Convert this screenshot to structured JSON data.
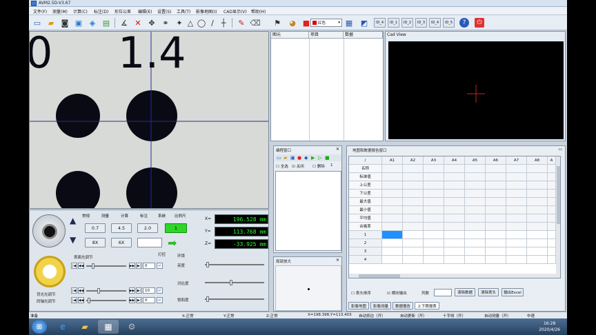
{
  "window": {
    "title": "AVM2.5D-V3.67"
  },
  "menu": [
    "文件(F)",
    "测量(M)",
    "计算(C)",
    "标注(D)",
    "形位公差",
    "编辑(E)",
    "设置(S)",
    "工具(T)",
    "影像地图(I)",
    "CAD显示(V)",
    "帮助(H)"
  ],
  "toolbar": {
    "color_select": "红色",
    "small_buttons": [
      "ID_4",
      "ID_1",
      "ID_2",
      "ID_3",
      "ID_4",
      "ID_5"
    ]
  },
  "camera": {
    "reading": "1.4",
    "left_digit": "0"
  },
  "element_table": {
    "headers": [
      "图元",
      "项目",
      "数据"
    ]
  },
  "cad_view": {
    "title": "Cad View"
  },
  "control": {
    "tabs": [
      "常规",
      "测量",
      "计算",
      "标注",
      "系统",
      "比例尺"
    ],
    "buttons": [
      "0.7",
      "4.5",
      "2.0",
      "1",
      "8X",
      "6X"
    ],
    "coords": [
      {
        "axis": "X=",
        "value": "196.528 mm"
      },
      {
        "axis": "Y=",
        "value": "113.768 mm"
      },
      {
        "axis": "Z=",
        "value": "-33.925 mm"
      }
    ],
    "light_label": "表面光调节",
    "ring_label": "背光光调节",
    "coax_label": "同轴光调节",
    "light_val": "0",
    "ring_val": "10",
    "coax_val": "0",
    "section_label": "环境",
    "light_section": "灯控",
    "brightness": "亮度",
    "contrast": "对比度",
    "saturation": "饱和度"
  },
  "program": {
    "title": "编程窗口",
    "select_all": "全选",
    "close": "关闭",
    "delete": "删除",
    "count": "1"
  },
  "zoom": {
    "title": "局部放大"
  },
  "measure": {
    "title": "地图和数据报告窗口",
    "columns": [
      "/",
      "A1",
      "A2",
      "A3",
      "A4",
      "A5",
      "A6",
      "A7",
      "A8",
      "A"
    ],
    "row_labels": [
      "名称",
      "标准值",
      "上公差",
      "下公差",
      "最大值",
      "最小值",
      "平均值",
      "合格率",
      "1",
      "2",
      "3",
      "4"
    ],
    "option1": "表头排序",
    "option2": "横向输出",
    "col_label": "列数",
    "btn_clear": "清除数据",
    "btn_clear2": "清除表头",
    "btn_export": "输出Excel",
    "tabs": [
      "影像地图",
      "影像测量",
      "数据报告",
      "上下限报表"
    ]
  },
  "status": {
    "left": "准备",
    "x_state": "X:正常",
    "y_state": "Y:正常",
    "z_state": "Z:正常",
    "pos": "X=198.398,Y=113.403",
    "auto_track": "自动抓边（开）",
    "auto_update": "自动更新（开）",
    "cross": "十字线（开）",
    "auto_measure": "自动测量（开）",
    "mid": "中速"
  },
  "taskbar": {
    "time": "16:28",
    "date": "2020/4/26"
  }
}
